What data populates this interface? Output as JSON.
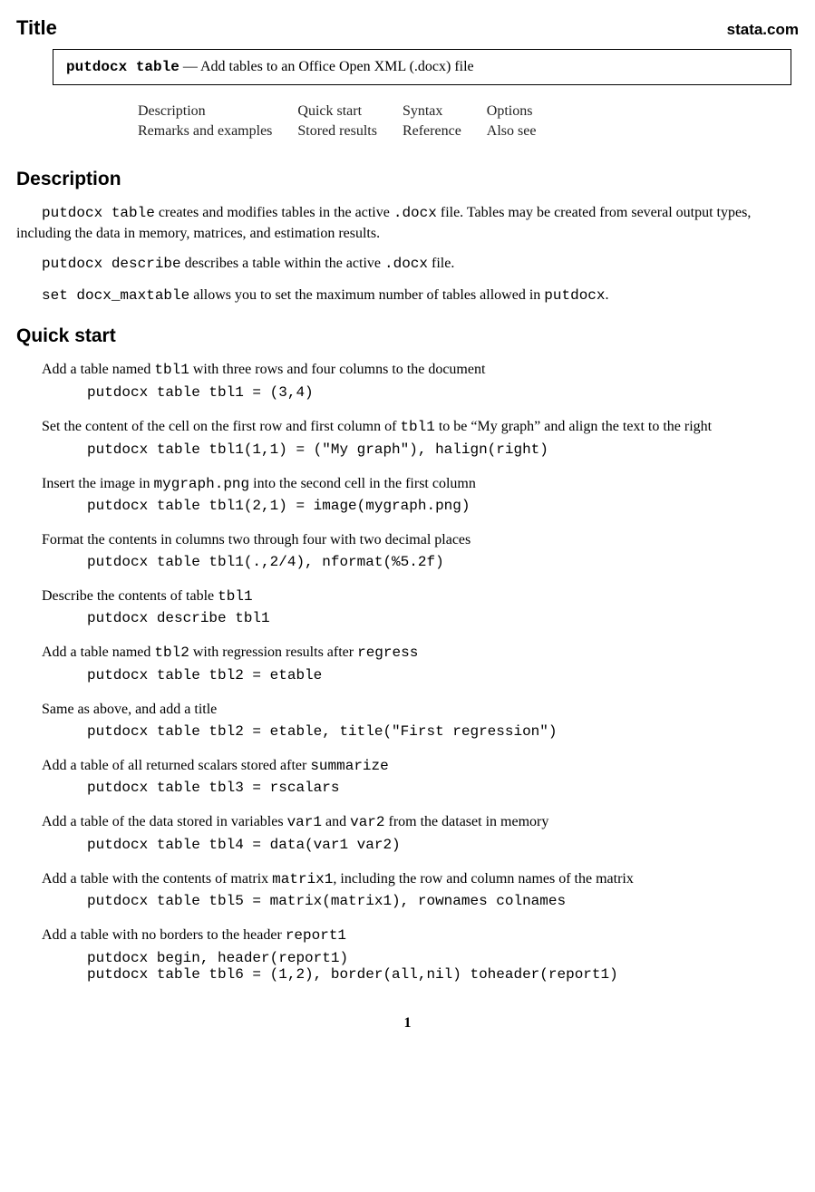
{
  "header": {
    "title": "Title",
    "brand": "stata.com"
  },
  "titlebox": {
    "cmd": "putdocx table",
    "sep": " — ",
    "desc": "Add tables to an Office Open XML (.docx) file"
  },
  "nav": {
    "r1c1": "Description",
    "r1c2": "Quick start",
    "r1c3": "Syntax",
    "r1c4": "Options",
    "r2c1": "Remarks and examples",
    "r2c2": "Stored results",
    "r2c3": "Reference",
    "r2c4": "Also see"
  },
  "sections": {
    "description": "Description",
    "quickstart": "Quick start"
  },
  "desc": {
    "p1a": "putdocx table",
    "p1b": " creates and modifies tables in the active ",
    "p1c": ".docx",
    "p1d": " file. Tables may be created from several output types, including the data in memory, matrices, and estimation results.",
    "p2a": "putdocx describe",
    "p2b": " describes a table within the active ",
    "p2c": ".docx",
    "p2d": " file.",
    "p3a": "set docx_maxtable",
    "p3b": " allows you to set the maximum number of tables allowed in ",
    "p3c": "putdocx",
    "p3d": "."
  },
  "qs": {
    "i1": {
      "t1": "Add a table named ",
      "c1": "tbl1",
      "t2": " with three rows and four columns to the document",
      "code": "putdocx table tbl1 = (3,4)"
    },
    "i2": {
      "t1": "Set the content of the cell on the first row and first column of ",
      "c1": "tbl1",
      "t2": " to be “My graph” and align the text to the right",
      "code": "putdocx table tbl1(1,1) = (\"My graph\"), halign(right)"
    },
    "i3": {
      "t1": "Insert the image in ",
      "c1": "mygraph.png",
      "t2": " into the second cell in the first column",
      "code": "putdocx table tbl1(2,1) = image(mygraph.png)"
    },
    "i4": {
      "t1": "Format the contents in columns two through four with two decimal places",
      "code": "putdocx table tbl1(.,2/4), nformat(%5.2f)"
    },
    "i5": {
      "t1": "Describe the contents of table ",
      "c1": "tbl1",
      "code": "putdocx describe tbl1"
    },
    "i6": {
      "t1": "Add a table named ",
      "c1": "tbl2",
      "t2": " with regression results after ",
      "c2": "regress",
      "code": "putdocx table tbl2 = etable"
    },
    "i7": {
      "t1": "Same as above, and add a title",
      "code": "putdocx table tbl2 = etable, title(\"First regression\")"
    },
    "i8": {
      "t1": "Add a table of all returned scalars stored after ",
      "c1": "summarize",
      "code": "putdocx table tbl3 = rscalars"
    },
    "i9": {
      "t1": "Add a table of the data stored in variables ",
      "c1": "var1",
      "t2": " and ",
      "c2": "var2",
      "t3": " from the dataset in memory",
      "code": "putdocx table tbl4 = data(var1 var2)"
    },
    "i10": {
      "t1": "Add a table with the contents of matrix ",
      "c1": "matrix1",
      "t2": ", including the row and column names of the matrix",
      "code": "putdocx table tbl5 = matrix(matrix1), rownames colnames"
    },
    "i11": {
      "t1": "Add a table with no borders to the header ",
      "c1": "report1",
      "code": "putdocx begin, header(report1)\nputdocx table tbl6 = (1,2), border(all,nil) toheader(report1)"
    }
  },
  "page": "1"
}
